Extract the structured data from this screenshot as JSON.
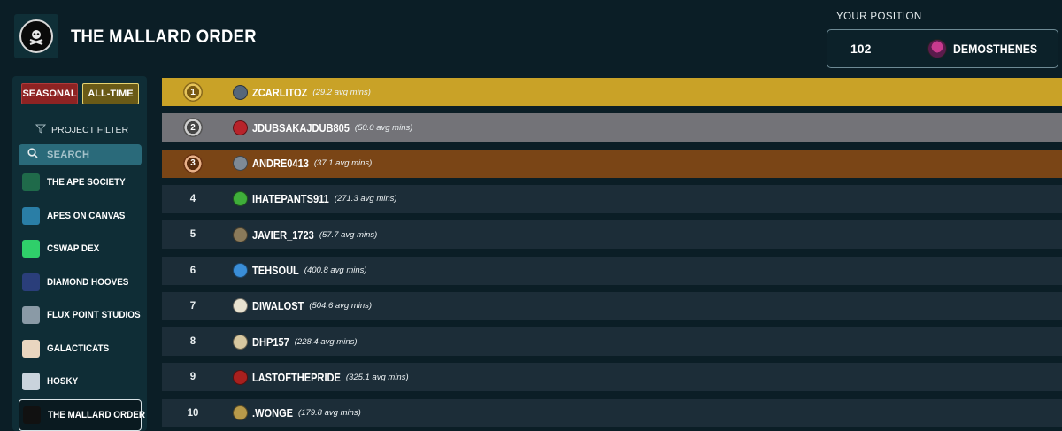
{
  "header": {
    "title": "THE MALLARD ORDER",
    "logo_icon": "skull-crossbones-icon"
  },
  "your_position": {
    "label": "YOUR POSITION",
    "rank": "102",
    "name": "DEMOSTHENES",
    "avatar_color": "#c83a8e"
  },
  "tabs": {
    "seasonal": "SEASONAL",
    "all_time": "ALL-TIME",
    "active": "ALL-TIME"
  },
  "filter": {
    "label": "PROJECT FILTER",
    "search_placeholder": "SEARCH"
  },
  "projects": [
    {
      "label": "THE APE SOCIETY",
      "color": "#1f6a4a",
      "active": false
    },
    {
      "label": "APES ON CANVAS",
      "color": "#2a7ea6",
      "active": false
    },
    {
      "label": "CSWAP DEX",
      "color": "#2fcf6a",
      "active": false
    },
    {
      "label": "DIAMOND HOOVES",
      "color": "#2a3e7a",
      "active": false
    },
    {
      "label": "FLUX POINT STUDIOS",
      "color": "#8a9aa6",
      "active": false
    },
    {
      "label": "GALACTICATS",
      "color": "#e9d6c0",
      "active": false
    },
    {
      "label": "HOSKY",
      "color": "#c9d3dc",
      "active": false
    },
    {
      "label": "THE MALLARD ORDER",
      "color": "#111111",
      "active": true
    }
  ],
  "leaderboard": [
    {
      "rank": "1",
      "name": "ZCARLITOZ",
      "avg": "(29.2 avg mins)",
      "tier": "gold",
      "avatar": "#56677a"
    },
    {
      "rank": "2",
      "name": "JDUBSAKAJDUB805",
      "avg": "(50.0 avg mins)",
      "tier": "silver",
      "avatar": "#b8232a"
    },
    {
      "rank": "3",
      "name": "ANDRE0413",
      "avg": "(37.1 avg mins)",
      "tier": "bronze",
      "avatar": "#7e8a96"
    },
    {
      "rank": "4",
      "name": "IHATEPANTS911",
      "avg": "(271.3 avg mins)",
      "tier": "",
      "avatar": "#3fae3a"
    },
    {
      "rank": "5",
      "name": "JAVIER_1723",
      "avg": "(57.7 avg mins)",
      "tier": "",
      "avatar": "#8a7a5a"
    },
    {
      "rank": "6",
      "name": "TEHSOUL",
      "avg": "(400.8 avg mins)",
      "tier": "",
      "avatar": "#3a8ed8"
    },
    {
      "rank": "7",
      "name": "DIWALOST",
      "avg": "(504.6 avg mins)",
      "tier": "",
      "avatar": "#e8e2d0"
    },
    {
      "rank": "8",
      "name": "DHP157",
      "avg": "(228.4 avg mins)",
      "tier": "",
      "avatar": "#d8c8a0"
    },
    {
      "rank": "9",
      "name": "LASTOFTHEPRIDE",
      "avg": "(325.1 avg mins)",
      "tier": "",
      "avatar": "#a8201e"
    },
    {
      "rank": "10",
      "name": ".WONGE",
      "avg": "(179.8 avg mins)",
      "tier": "",
      "avatar": "#b89a4a"
    }
  ]
}
